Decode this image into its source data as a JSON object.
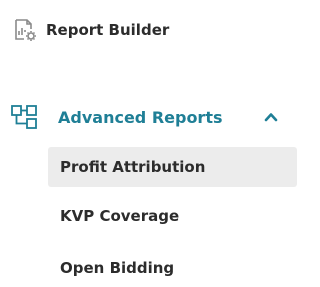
{
  "nav": {
    "report_builder": {
      "label": "Report Builder",
      "icon": "report-builder-icon"
    },
    "advanced_reports": {
      "label": "Advanced Reports",
      "icon": "hierarchy-icon",
      "expanded": true,
      "accent_color": "#1f7f96",
      "items": [
        {
          "label": "Profit Attribution",
          "active": true
        },
        {
          "label": "KVP Coverage",
          "active": false
        },
        {
          "label": "Open Bidding",
          "active": false
        }
      ]
    }
  }
}
